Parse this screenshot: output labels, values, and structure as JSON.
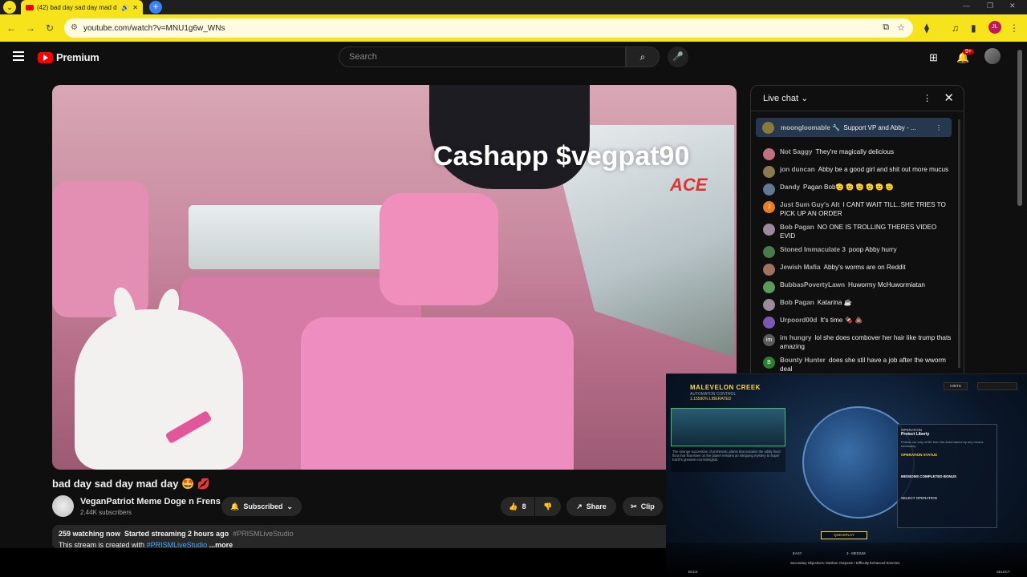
{
  "browser": {
    "tab_title": "(42) bad day sad day mad d",
    "url": "youtube.com/watch?v=MNU1g6w_WNs",
    "profile_initials": "JL"
  },
  "header": {
    "brand": "Premium",
    "search_placeholder": "Search",
    "notification_badge": "9+"
  },
  "video": {
    "overlay_text": "Cashapp $vegpat90",
    "sign_text": "ACE",
    "title": "bad day sad day mad day 🤩 💋",
    "channel_name": "VeganPatriot Meme Doge n Frens",
    "subscribers": "2.44K subscribers",
    "subscribe_label": "Subscribed",
    "likes": "8",
    "share_label": "Share",
    "clip_label": "Clip",
    "watching": "259 watching now",
    "started": "Started streaming 2 hours ago",
    "hashtag": "#PRISMLiveStudio",
    "desc_line2_prefix": "This stream is created with",
    "desc_line2_link": "#PRISMLiveStudio",
    "more_label": "...more"
  },
  "chat": {
    "title": "Live chat",
    "pinned": {
      "author": "moongloomable 🔧",
      "text": "Support VP and Abby - ..."
    },
    "messages": [
      {
        "author": "Not Saggy",
        "text": "They're magically delicious",
        "color": "#c07080",
        "initial": ""
      },
      {
        "author": "jon duncan",
        "text": "Abby be a good girl and shit out more mucus",
        "color": "#8a7a50",
        "initial": ""
      },
      {
        "author": "Dandy",
        "text": "Pagan Bob🫡 🫡 🫡 🫡 🫡 🫡",
        "color": "#607890",
        "initial": ""
      },
      {
        "author": "Just Sum Guy's Alt",
        "text": "I CANT WAIT TILL..SHE TRIES TO PICK UP AN ORDER",
        "color": "#e67e22",
        "initial": "J"
      },
      {
        "author": "Bob Pagan",
        "text": "NO ONE IS TROLLING THERES VIDEO EVID",
        "color": "#9a8a9a",
        "initial": ""
      },
      {
        "author": "Stoned Immaculate 3",
        "text": "poop Abby hurry",
        "color": "#4a7a4a",
        "initial": ""
      },
      {
        "author": "Jewish Mafia",
        "text": "Abby's worms are on Reddit",
        "color": "#a07060",
        "initial": ""
      },
      {
        "author": "BubbasPovertyLawn",
        "text": "Huwormy McHuwormiatan",
        "color": "#5a9a5a",
        "initial": ""
      },
      {
        "author": "Bob Pagan",
        "text": "Katarina ☕",
        "color": "#9a8a9a",
        "initial": ""
      },
      {
        "author": "Urpoord00d",
        "text": "It's time 🍫 💩",
        "color": "#7a5ab0",
        "initial": ""
      },
      {
        "author": "im hungry",
        "text": "lol she does combover her hair like trump thats amazing",
        "color": "#5a5a5a",
        "initial": "im"
      },
      {
        "author": "Bounty Hunter",
        "text": "does she stil have a job after the wworm deal",
        "color": "#2e7d32",
        "initial": "B"
      }
    ]
  },
  "game": {
    "title": "MALEVELON CREEK",
    "subtitle": "AUTOMATON CONTROL",
    "percent": "1.15590% LIBERATED",
    "description": "The strange succession of prehistoric plants that sustains the oddly fixed flora that flourishes on the planet remains an intriguing mystery to Super Earth's greatest eco-biologists.",
    "hint_label": "HINTS",
    "op_header": "OPERATION",
    "op_title": "Protect Liberty",
    "op_desc": "Protect our way of life from the Automatons by any means necessary.",
    "op_status": "OPERATION STATUS",
    "missions_bonus": "MISSIONS COMPLETED BONUS",
    "select_op": "SELECT OPERATION",
    "quickplay": "QUICKPLAY",
    "difficulty": "EASY",
    "difficulty2": "3 - MEDIUM",
    "back": "BACK",
    "select": "SELECT",
    "secondary": "Secondary Objectives: Medium Outposts • Difficulty Enhanced Enemies"
  }
}
